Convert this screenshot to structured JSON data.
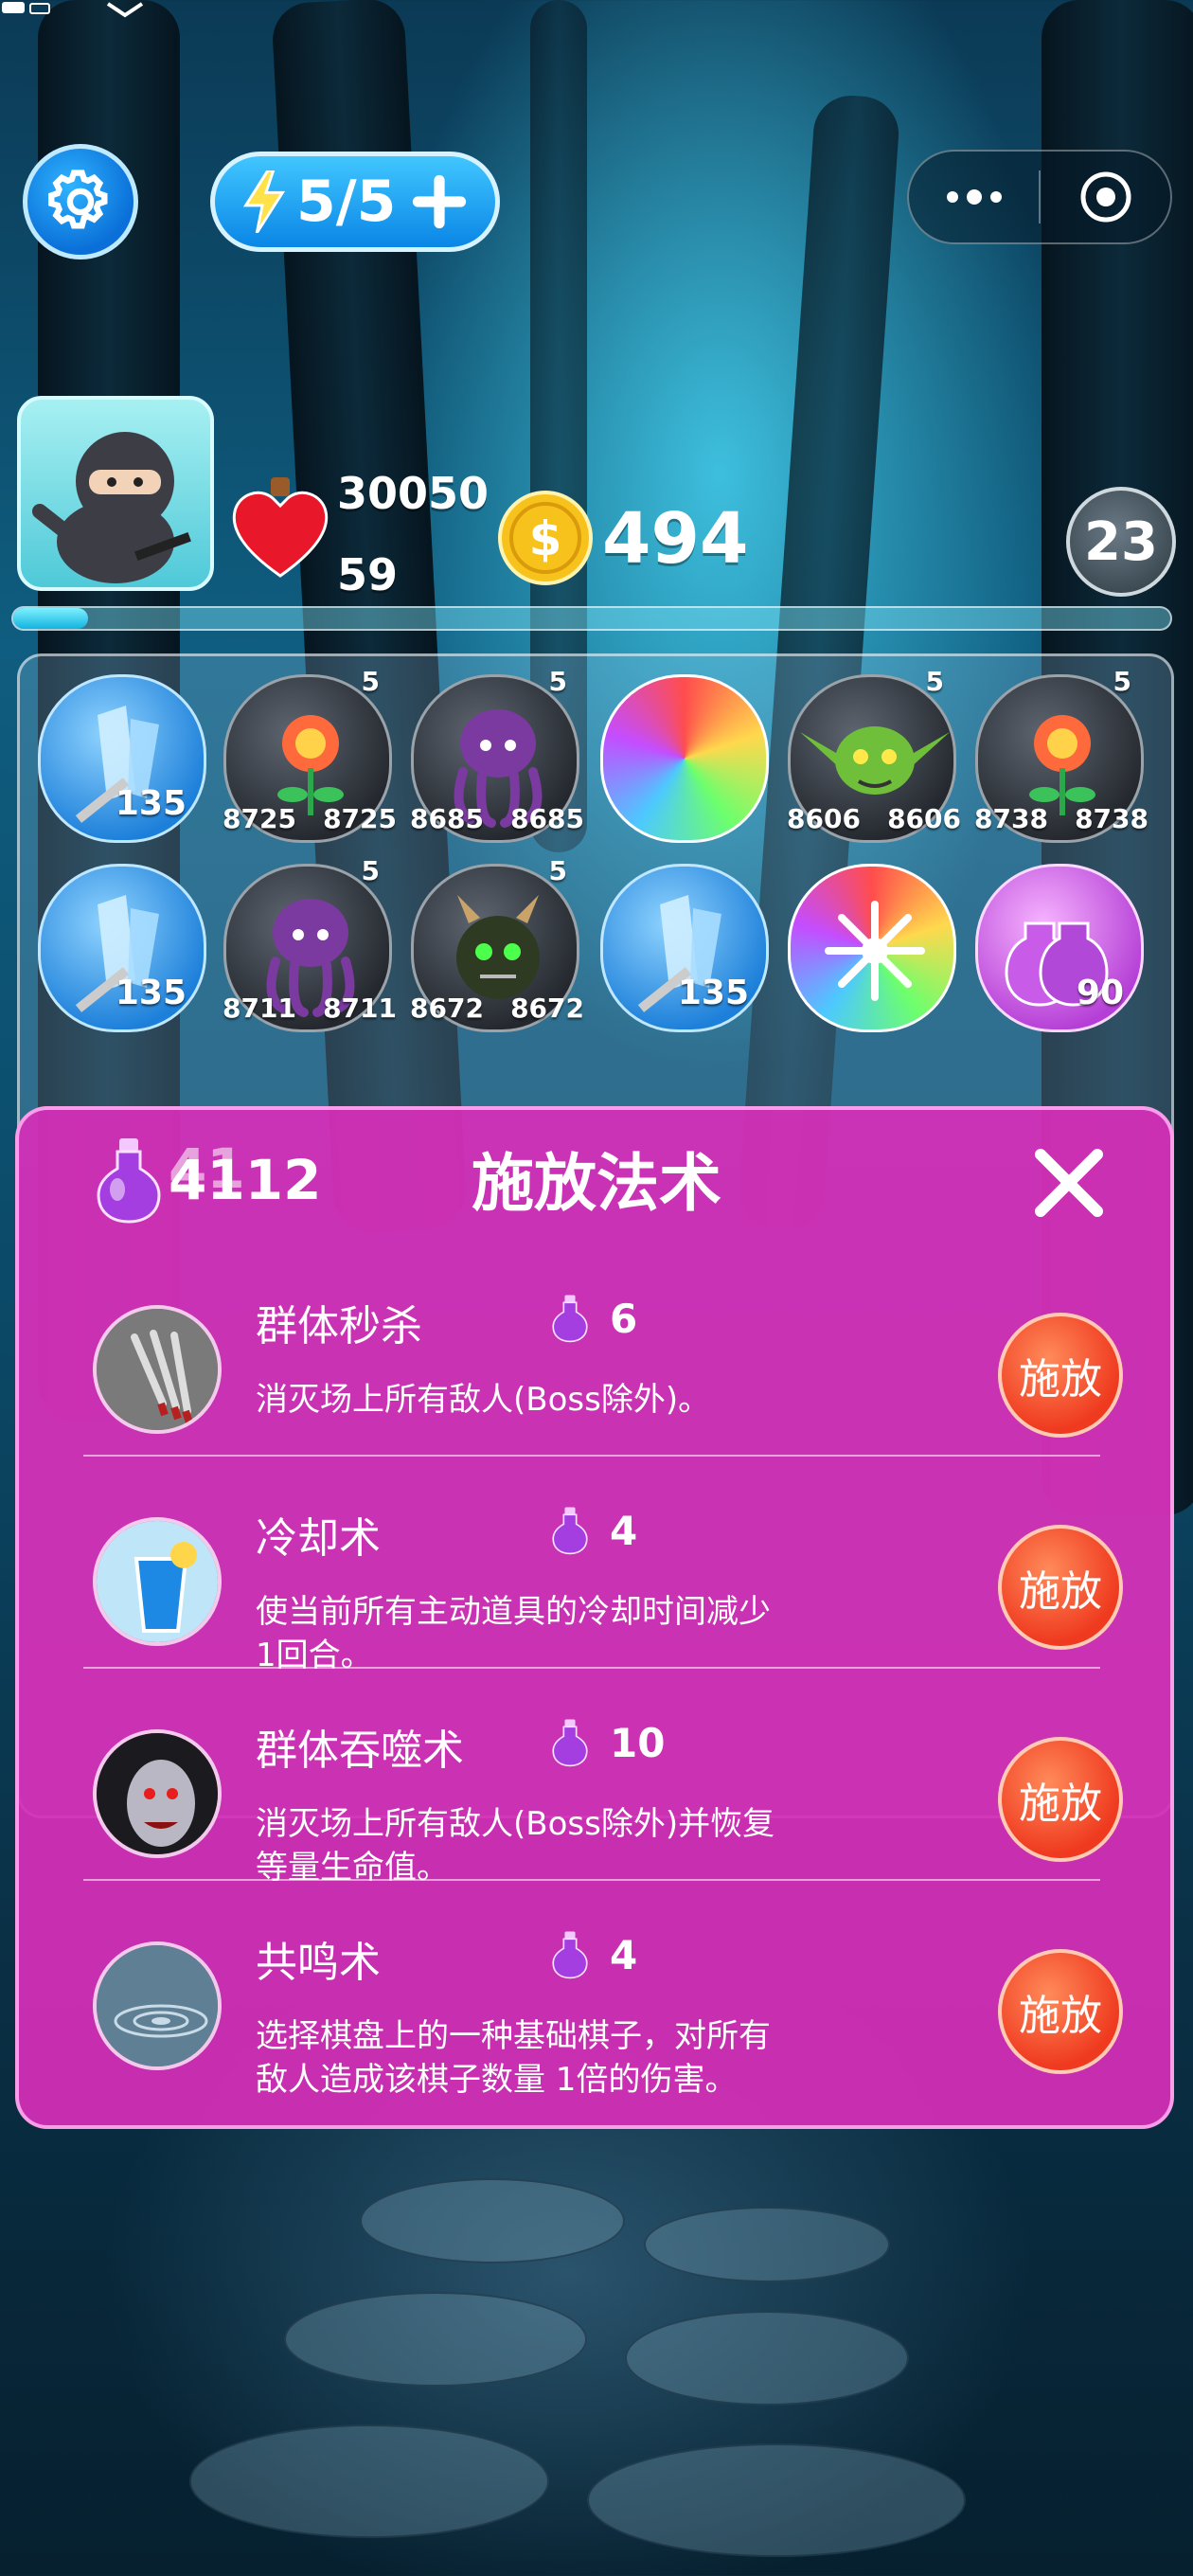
{
  "status_bar": {
    "sim_icon": "sim-icon",
    "chevron": "chevron-down-icon"
  },
  "top_bar": {
    "settings_icon": "gear-icon",
    "energy": {
      "icon": "lightning-icon",
      "value": "5/5",
      "add_icon": "plus-icon"
    },
    "mini_program": {
      "more_icon": "more-dots-icon",
      "exit_icon": "target-circle-icon"
    }
  },
  "player": {
    "avatar": "ninja-avatar",
    "hp": "30050",
    "hp_secondary": "59",
    "coins": "494",
    "level": "23",
    "progress": 0.065
  },
  "board": {
    "rows": [
      [
        {
          "kind": "crystal",
          "value": "135"
        },
        {
          "kind": "monster",
          "creature": "flower",
          "top": "5",
          "atk": "8725",
          "hp": "8725"
        },
        {
          "kind": "monster",
          "creature": "octopus",
          "top": "5",
          "atk": "8685",
          "hp": "8685"
        },
        {
          "kind": "rainbow"
        },
        {
          "kind": "monster",
          "creature": "goblin",
          "top": "5",
          "atk": "8606",
          "hp": "8606"
        },
        {
          "kind": "monster",
          "creature": "flower",
          "top": "5",
          "atk": "8738",
          "hp": "8738"
        }
      ],
      [
        {
          "kind": "crystal",
          "value": "135"
        },
        {
          "kind": "monster",
          "creature": "octopus",
          "top": "5",
          "atk": "8711",
          "hp": "8711"
        },
        {
          "kind": "monster",
          "creature": "dragon",
          "top": "5",
          "atk": "8672",
          "hp": "8672"
        },
        {
          "kind": "crystal",
          "value": "135"
        },
        {
          "kind": "rainbow-star"
        },
        {
          "kind": "potion",
          "value": "90"
        }
      ]
    ]
  },
  "modal": {
    "title": "施放法术",
    "mana_value": "4112",
    "mana_overlay": "41",
    "close_icon": "close-icon",
    "spells": [
      {
        "name": "群体秒杀",
        "cost": "6",
        "desc": "消灭场上所有敌人(Boss除外)。",
        "button": "施放",
        "icon": "daggers-icon"
      },
      {
        "name": "冷却术",
        "cost": "4",
        "desc": "使当前所有主动道具的冷却时间减少1回合。",
        "button": "施放",
        "icon": "cold-drink-icon"
      },
      {
        "name": "群体吞噬术",
        "cost": "10",
        "desc": "消灭场上所有敌人(Boss除外)并恢复等量生命值。",
        "button": "施放",
        "icon": "vampire-icon"
      },
      {
        "name": "共鸣术",
        "cost": "4",
        "desc": "选择棋盘上的一种基础棋子，对所有敌人造成该棋子数量 1倍的伤害。",
        "button": "施放",
        "icon": "ripple-icon"
      }
    ]
  }
}
